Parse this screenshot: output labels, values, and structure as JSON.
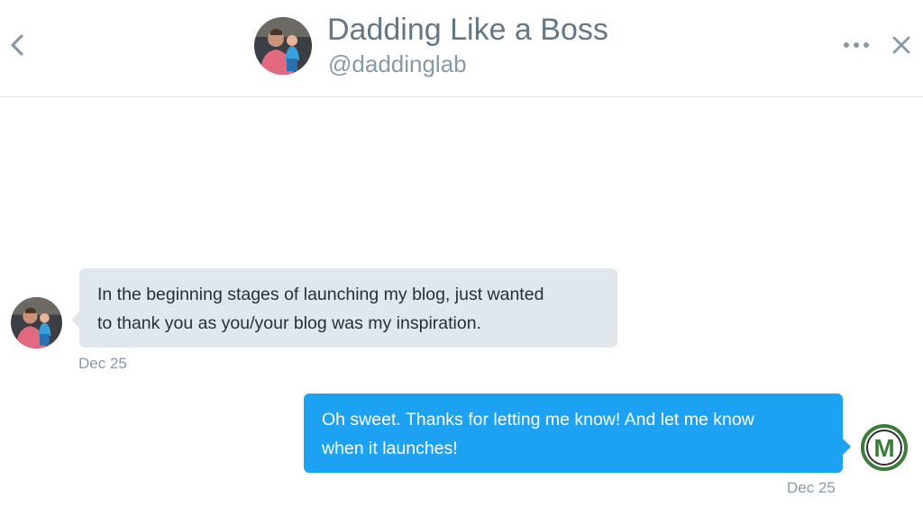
{
  "header": {
    "back_icon": "chevron-left-icon",
    "display_name": "Dadding Like a Boss",
    "handle": "@daddinglab",
    "more_icon": "more-horizontal-icon",
    "close_icon": "close-icon"
  },
  "messages": [
    {
      "direction": "incoming",
      "lines": [
        "In the beginning stages of launching my blog, just wanted",
        "to thank you as you/your blog was my inspiration."
      ],
      "timestamp": "Dec 25"
    },
    {
      "direction": "outgoing",
      "lines": [
        "Oh sweet. Thanks for letting me know! And let me know",
        "when it launches!"
      ],
      "timestamp": "Dec 25"
    }
  ],
  "colors": {
    "incoming_bubble": "#e1e8ed",
    "outgoing_bubble": "#1da1f2",
    "outgoing_logo_ring": "#3a7d3a"
  },
  "self_avatar": {
    "logo_letter": "M"
  }
}
